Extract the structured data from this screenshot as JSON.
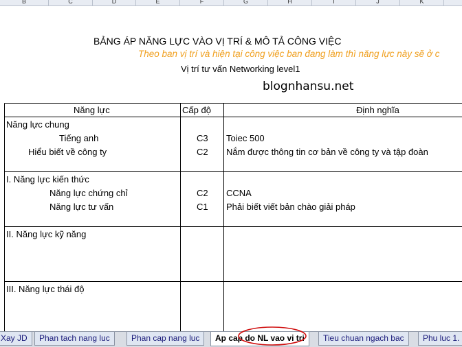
{
  "columns": [
    "B",
    "C",
    "D",
    "E",
    "F",
    "G",
    "H",
    "I",
    "J",
    "K"
  ],
  "heading": {
    "title": "BẢNG ÁP NĂNG LỰC VÀO VỊ TRÍ & MÔ TẢ CÔNG VIỆC",
    "subtitle": "Theo ban vị trí và hiện tại công việc ban đang làm thì năng lực này sẽ ở c",
    "position": "Vị trí tư vấn Networking level1",
    "site": "blognhansu.net"
  },
  "table": {
    "headers": {
      "competency": "Năng lực",
      "level": "Cấp độ",
      "definition": "Định nghĩa"
    },
    "sections": [
      {
        "title": "Năng lực chung",
        "items": [
          {
            "name": "Tiếng anh",
            "level": "C3",
            "definition": "Toiec 500"
          },
          {
            "name": "Hiểu biết về công ty",
            "level": "C2",
            "definition": "Nắm được thông tin cơ bản về công ty và tập đoàn"
          }
        ]
      },
      {
        "title": "I. Năng lực kiến thức",
        "items": [
          {
            "name": "Năng lực chứng chỉ",
            "level": "C2",
            "definition": "CCNA"
          },
          {
            "name": "Năng lực tư vấn",
            "level": "C1",
            "definition": "Phải biết viết bản chào giải pháp"
          }
        ]
      },
      {
        "title": "II. Năng lực kỹ năng",
        "items": []
      },
      {
        "title": "III. Năng lực thái độ",
        "items": []
      }
    ]
  },
  "sheet_tabs": [
    {
      "label": "Xay JD",
      "active": false
    },
    {
      "label": "Phan tach nang luc",
      "active": false
    },
    {
      "label": "Phan cap nang luc",
      "active": false
    },
    {
      "label": "Ap cap do NL vao vi tri",
      "active": true
    },
    {
      "label": "Tieu chuan ngach bac",
      "active": false
    },
    {
      "label": "Phu luc 1.",
      "active": false
    }
  ],
  "colors": {
    "subtitle": "#f0a020",
    "annotation_circle": "#d01010"
  }
}
